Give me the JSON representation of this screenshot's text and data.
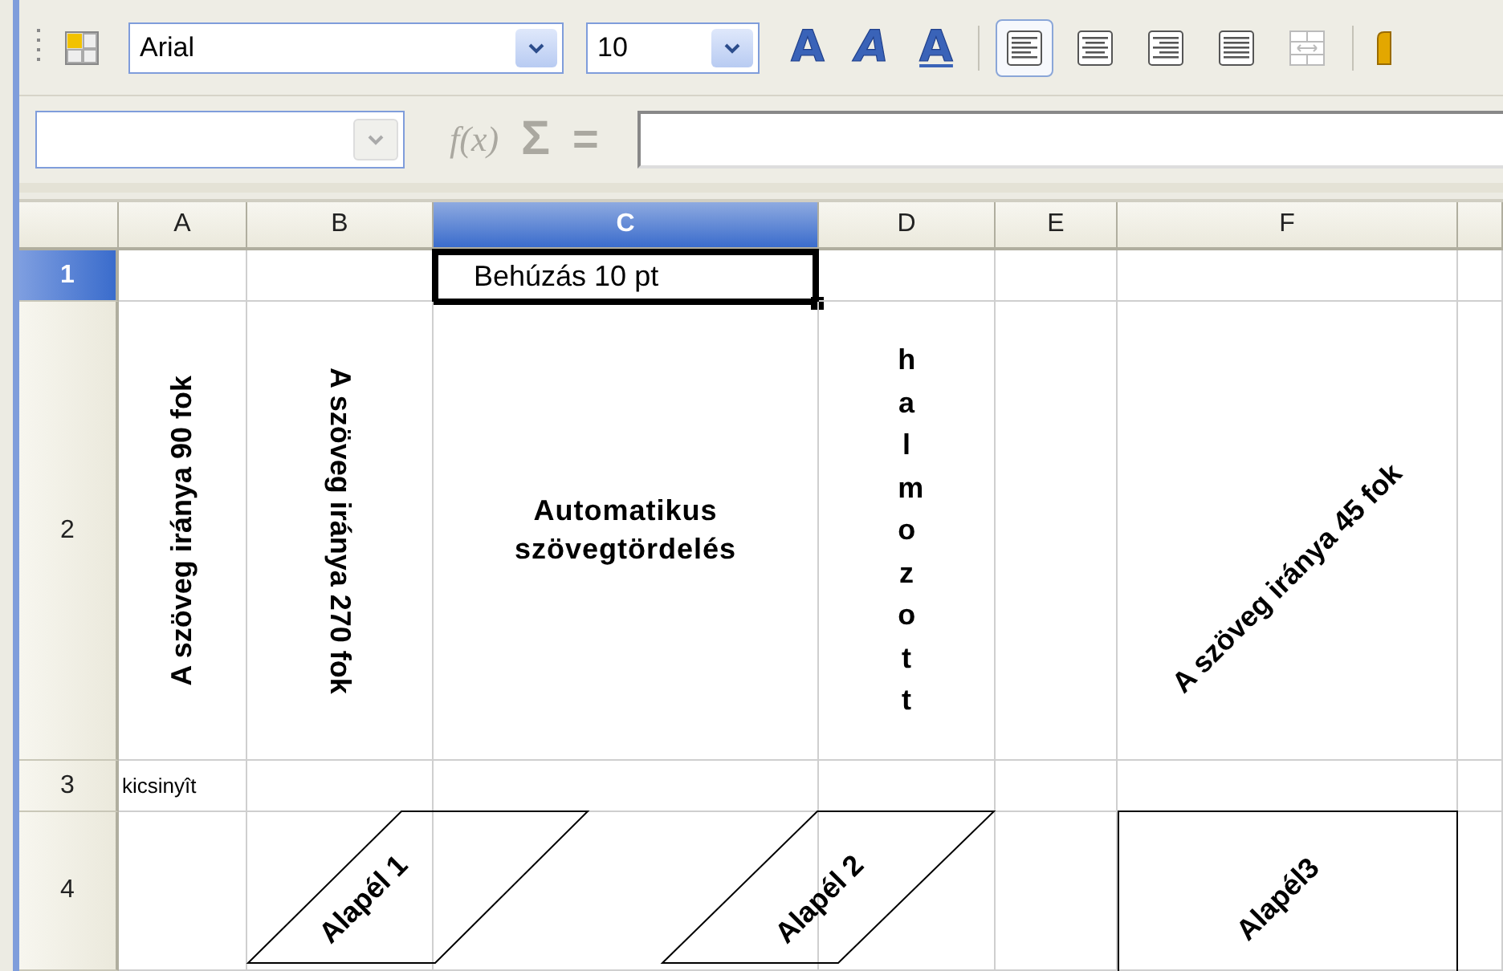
{
  "toolbar": {
    "font_name": "Arial",
    "font_size": "10",
    "text_buttons": [
      {
        "label": "A",
        "kind": "bold"
      },
      {
        "label": "A",
        "kind": "italic"
      },
      {
        "label": "A",
        "kind": "underline"
      }
    ],
    "align_buttons": [
      {
        "kind": "left",
        "selected": true,
        "disabled": false
      },
      {
        "kind": "center",
        "selected": false,
        "disabled": false
      },
      {
        "kind": "right",
        "selected": false,
        "disabled": false
      },
      {
        "kind": "justify",
        "selected": false,
        "disabled": false
      },
      {
        "kind": "merge",
        "selected": false,
        "disabled": true
      }
    ]
  },
  "formula_bar": {
    "function_symbol": "f(x)",
    "sum_symbol": "Σ",
    "equals_symbol": "="
  },
  "sheet": {
    "columns": [
      {
        "label": "A",
        "selected": false
      },
      {
        "label": "B",
        "selected": false
      },
      {
        "label": "C",
        "selected": true
      },
      {
        "label": "D",
        "selected": false
      },
      {
        "label": "E",
        "selected": false
      },
      {
        "label": "F",
        "selected": false
      }
    ],
    "rows": [
      {
        "label": "1",
        "selected": true,
        "cells": [
          {
            "kind": "blank"
          },
          {
            "kind": "blank"
          },
          {
            "kind": "indent",
            "text": "Behúzás 10 pt",
            "active": true
          },
          {
            "kind": "blank"
          },
          {
            "kind": "blank"
          },
          {
            "kind": "blank"
          }
        ]
      },
      {
        "label": "2",
        "selected": false,
        "cells": [
          {
            "kind": "rotate90",
            "text": "A szöveg iránya 90 fok"
          },
          {
            "kind": "rotate270",
            "text": "A szöveg iránya 270 fok"
          },
          {
            "kind": "wrap",
            "text": "Automatikus szövegtördelés"
          },
          {
            "kind": "stacked",
            "text": "halmozott"
          },
          {
            "kind": "blank"
          },
          {
            "kind": "rotate45",
            "text": "A szöveg iránya 45 fok"
          }
        ]
      },
      {
        "label": "3",
        "selected": false,
        "cells": [
          {
            "kind": "shrink",
            "text": "kicsinyît"
          },
          {
            "kind": "blank"
          },
          {
            "kind": "blank"
          },
          {
            "kind": "blank"
          },
          {
            "kind": "blank"
          },
          {
            "kind": "blank"
          }
        ]
      },
      {
        "label": "4",
        "selected": false,
        "cells": [
          {
            "kind": "blank"
          },
          {
            "kind": "slant-up",
            "text": "Alapél 1"
          },
          {
            "kind": "blank"
          },
          {
            "kind": "slant-down",
            "text": "Alapél 2"
          },
          {
            "kind": "blank"
          },
          {
            "kind": "boxed45",
            "text": "Alapél3"
          }
        ]
      }
    ]
  }
}
